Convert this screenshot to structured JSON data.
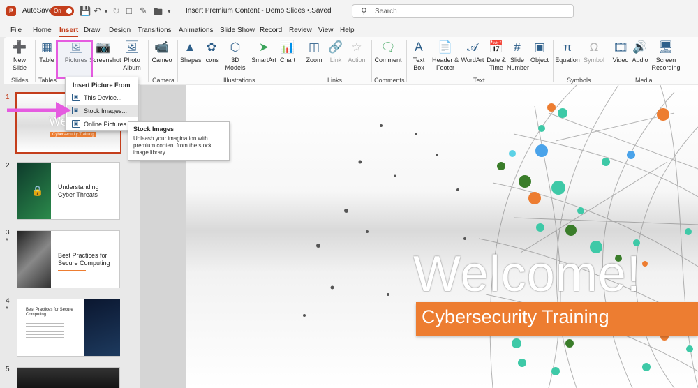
{
  "titlebar": {
    "autosave_label": "AutoSave",
    "autosave_state": "On",
    "doc_title": "Insert Premium Content - Demo Slides • Saved",
    "search_placeholder": "Search"
  },
  "tabs": [
    "File",
    "Home",
    "Insert",
    "Draw",
    "Design",
    "Transitions",
    "Animations",
    "Slide Show",
    "Record",
    "Review",
    "View",
    "Help"
  ],
  "active_tab": "Insert",
  "ribbon": {
    "new_slide": "New Slide",
    "table": "Table",
    "pictures": "Pictures",
    "screenshot": "Screenshot",
    "photo_album": "Photo Album",
    "cameo": "Cameo",
    "shapes": "Shapes",
    "icons": "Icons",
    "models3d": "3D Models",
    "smartart": "SmartArt",
    "chart": "Chart",
    "zoom": "Zoom",
    "link": "Link",
    "action": "Action",
    "comment": "Comment",
    "text_box": "Text Box",
    "header_footer": "Header & Footer",
    "wordart": "WordArt",
    "date_time": "Date & Time",
    "slide_number": "Slide Number",
    "object": "Object",
    "equation": "Equation",
    "symbol": "Symbol",
    "video": "Video",
    "audio": "Audio",
    "screen_recording": "Screen Recording",
    "groups": {
      "slides": "Slides",
      "tables": "Tables",
      "camera": "Camera",
      "illustrations": "Illustrations",
      "links": "Links",
      "comments": "Comments",
      "text": "Text",
      "symbols": "Symbols",
      "media": "Media"
    }
  },
  "menu": {
    "header": "Insert Picture From",
    "items": [
      "This Device...",
      "Stock Images...",
      "Online Pictures..."
    ]
  },
  "tooltip": {
    "title": "Stock Images",
    "description": "Unleash your imagination with premium content from the stock image library."
  },
  "slides": [
    {
      "num": "1",
      "title": "Welcome!",
      "subtitle": "Cybersecurity Training"
    },
    {
      "num": "2",
      "title": "Understanding Cyber Threats"
    },
    {
      "num": "3",
      "title": "Best Practices for Secure Computing",
      "star": "*"
    },
    {
      "num": "4",
      "title": "Best Practices for Secure Computing",
      "star": "*"
    },
    {
      "num": "5"
    }
  ],
  "current_slide": {
    "title": "Welcome!",
    "subtitle": "Cybersecurity Training"
  },
  "colors": {
    "accent": "#c43e1c",
    "orange": "#ed7d31",
    "highlight": "#e55be0"
  }
}
